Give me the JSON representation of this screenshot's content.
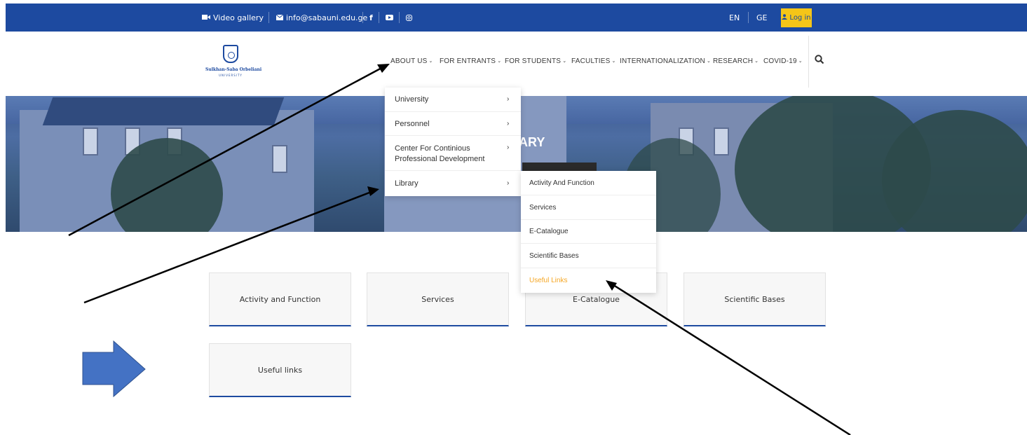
{
  "topbar": {
    "video_gallery": "Video gallery",
    "email": "info@sabauni.edu.ge",
    "facebook": "f",
    "lang_en": "EN",
    "lang_ge": "GE",
    "login": "Log in",
    "background": "#1d4aa0",
    "login_color": "#f5c518"
  },
  "logo": {
    "name": "Sulkhan-Saba Orbeliani",
    "sub": "UNIVERSITY"
  },
  "nav": {
    "items": [
      {
        "label": "ABOUT US"
      },
      {
        "label": "FOR ENTRANTS"
      },
      {
        "label": "FOR STUDENTS"
      },
      {
        "label": "FACULTIES"
      },
      {
        "label": "INTERNATIONALIZATION"
      },
      {
        "label": "RESEARCH"
      },
      {
        "label": "COVID-19"
      }
    ]
  },
  "hero": {
    "title_fragment": "ARY"
  },
  "about_menu": {
    "items": [
      {
        "label": "University"
      },
      {
        "label": "Personnel"
      },
      {
        "label": "Center For Continious Professional Development"
      },
      {
        "label": "Library"
      }
    ]
  },
  "library_menu": {
    "items": [
      {
        "label": "Activity And Function"
      },
      {
        "label": "Services"
      },
      {
        "label": "E-Catalogue"
      },
      {
        "label": "Scientific Bases"
      },
      {
        "label": "Useful Links",
        "active": true
      }
    ],
    "active_color": "#f5a623"
  },
  "cards": {
    "items": [
      {
        "label": "Activity and Function"
      },
      {
        "label": "Services"
      },
      {
        "label": "E-Catalogue"
      },
      {
        "label": "Scientific Bases"
      },
      {
        "label": "Useful links"
      }
    ],
    "accent": "#1d4aa0"
  },
  "annotations": {
    "arrow_color": "#000000",
    "block_arrow_color": "#4472c4"
  }
}
